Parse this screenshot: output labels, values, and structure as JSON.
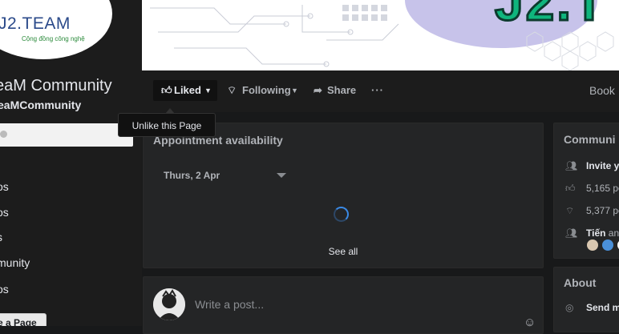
{
  "sidebar": {
    "logo_text": "J2.TEAM",
    "logo_tagline": "Cộng đồng công nghệ",
    "page_title": "eaM Community",
    "page_handle": "eaMCommunity",
    "nav": [
      {
        "label": "t"
      },
      {
        "label": "os"
      },
      {
        "label": "os"
      },
      {
        "label": "s"
      },
      {
        "label": "munity"
      },
      {
        "label": "os"
      }
    ],
    "create_page_label": "te a Page"
  },
  "cover": {
    "headline": "J2.T"
  },
  "actionbar": {
    "liked_label": "Liked",
    "following_label": "Following",
    "share_label": "Share",
    "more_label": "···",
    "book_label": "Book"
  },
  "tooltip": {
    "text": "Unlike this Page"
  },
  "appointment": {
    "title": "Appointment availability",
    "date": "Thurs, 2 Apr",
    "see_all": "See all"
  },
  "composer": {
    "placeholder": "Write a post..."
  },
  "community": {
    "title": "Communi",
    "invite": "Invite y",
    "likes": "5,165 pe",
    "follows": "5,377 pe",
    "friend_name": "Tiến",
    "friend_suffix": " an"
  },
  "about": {
    "title": "About",
    "send": "Send m"
  },
  "colors": {
    "bg": "#18191a",
    "card": "#242526",
    "accent_blue": "#3a8ae6",
    "cover_green": "#0fb57d"
  }
}
